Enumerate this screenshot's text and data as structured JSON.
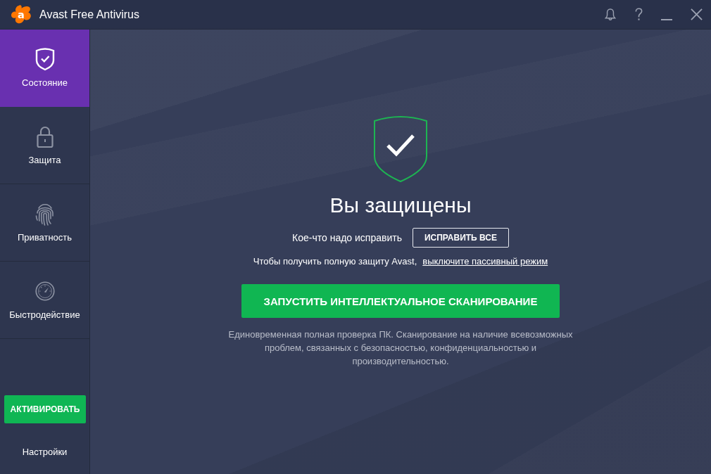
{
  "window": {
    "logo": "a",
    "title": "Avast Free Antivirus"
  },
  "sidebar": {
    "items": [
      {
        "label": "Состояние",
        "selected": true
      },
      {
        "label": "Защита",
        "selected": false
      },
      {
        "label": "Приватность",
        "selected": false
      },
      {
        "label": "Быстродействие",
        "selected": false
      }
    ],
    "activate_button": "АКТИВИРОВАТЬ",
    "settings_link": "Настройки"
  },
  "status": {
    "title": "Вы защищены",
    "notice": "Кое-что надо исправить",
    "fix_button": "ИСПРАВИТЬ ВСЕ",
    "passive_mode_text": "Чтобы получить полную защиту Avast,",
    "passive_mode_link": "выключите пассивный режим",
    "scan_button": "ЗАПУСТИТЬ ИНТЕЛЛЕКТУАЛЬНОЕ СКАНИРОВАНИЕ",
    "scan_description": "Единовременная полная проверка ПК. Сканирование на наличие всевозможных проблем, связанных с безопасностью, конфиденциальностью и производительностью."
  }
}
